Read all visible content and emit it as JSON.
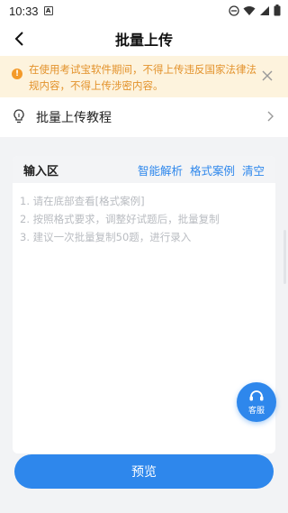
{
  "status": {
    "time": "10:33",
    "a_icon": "A"
  },
  "header": {
    "title": "批量上传"
  },
  "notice": {
    "text": "在使用考试宝软件期间，不得上传违反国家法律法规内容，不得上传涉密内容。",
    "accent": "#f39a2a"
  },
  "tutorial": {
    "label": "批量上传教程"
  },
  "input_area": {
    "title": "输入区",
    "actions": [
      "智能解析",
      "格式案例",
      "清空"
    ],
    "placeholder_lines": [
      "1. 请在底部查看[格式案例]",
      "2. 按照格式要求，调整好试题后，批量复制",
      "3. 建议一次批量复制50题，进行录入"
    ]
  },
  "customer_service": {
    "label": "客服"
  },
  "footer": {
    "preview_label": "预览"
  },
  "colors": {
    "primary": "#2e87ec",
    "notice_bg": "#fdf3dd",
    "notice_text": "#e3922b"
  }
}
